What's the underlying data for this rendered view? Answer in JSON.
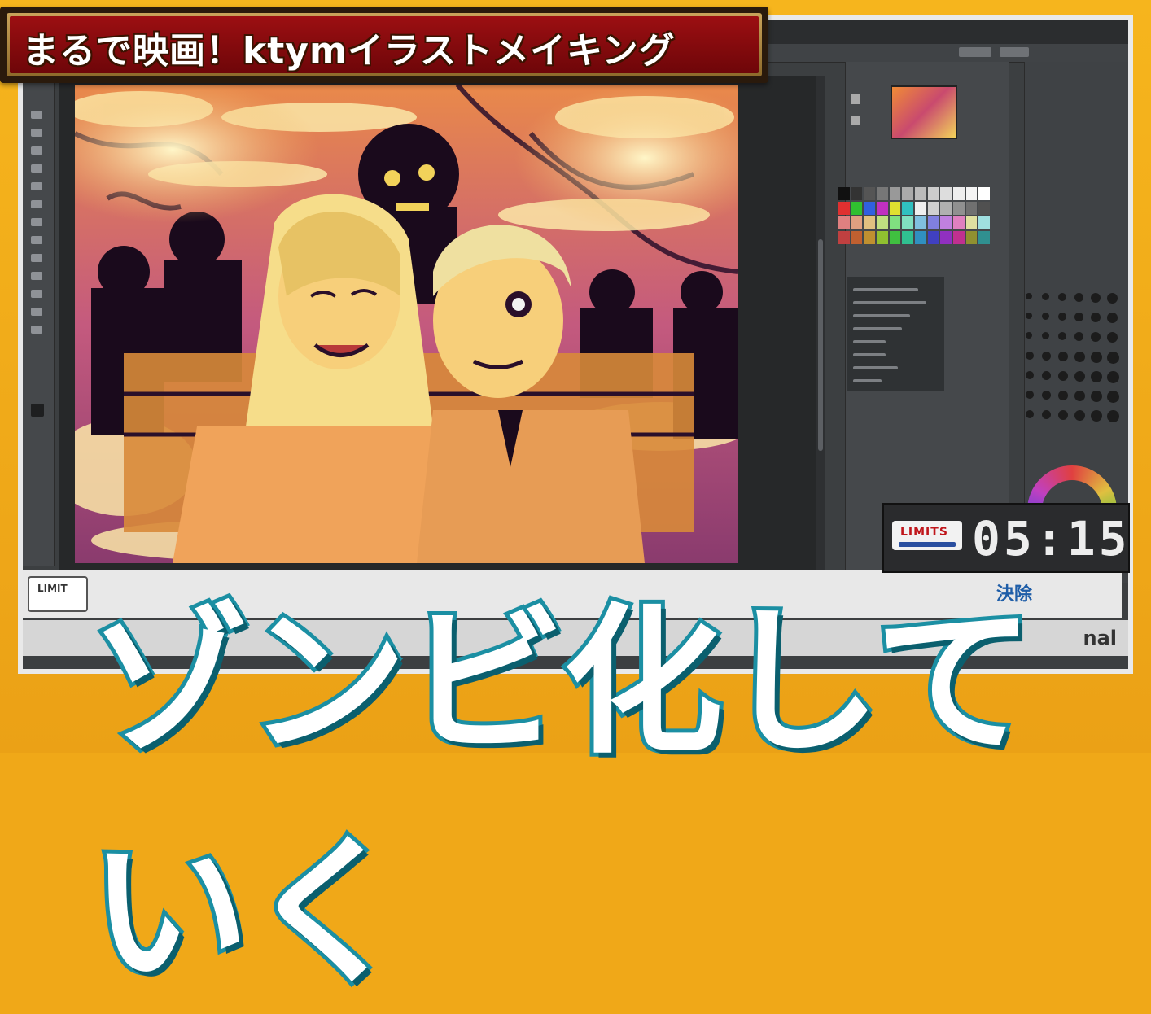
{
  "banner": {
    "title": "まるで映画！ktymイラストメイキング"
  },
  "caption": {
    "text": "ゾンビ化していく"
  },
  "timer": {
    "logo": "LIMITS",
    "value": "05:15"
  },
  "bottom_bar": {
    "left_logo": "LIMIT",
    "right_text": "決除",
    "final_text": "nal"
  },
  "colors": {
    "frame": "#f0a818",
    "banner_red": "#9c0f12",
    "caption_stroke": "#1b8fa3",
    "illustration_purple": "#3a1535",
    "illustration_orange": "#f0903a"
  },
  "icons": [
    "menu-icon",
    "brush-tool-icon",
    "eraser-icon",
    "layer-icon",
    "navigator-icon",
    "color-wheel-icon"
  ]
}
